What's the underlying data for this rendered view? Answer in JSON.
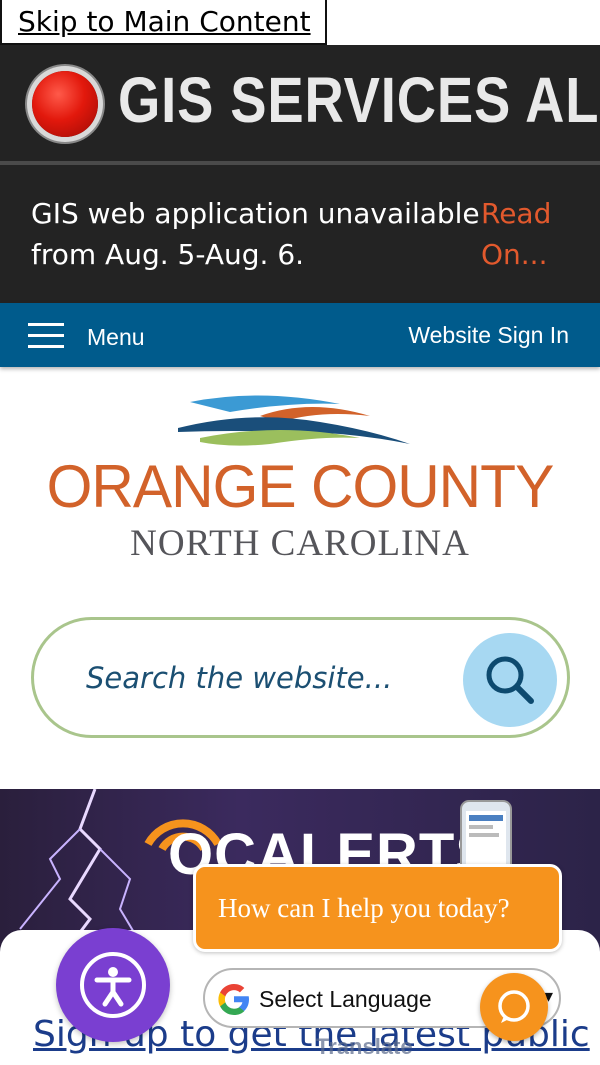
{
  "skip_link": "Skip to Main Content",
  "alert": {
    "title": "GIS SERVICES ALERT",
    "message": "GIS web application unavailable from Aug. 5-Aug. 6.",
    "read_more": "Read On..."
  },
  "nav": {
    "menu_label": "Menu",
    "sign_in": "Website Sign In"
  },
  "logo": {
    "line1": "ORANGE COUNTY",
    "line2": "NORTH CAROLINA"
  },
  "search": {
    "placeholder": "Search the website...",
    "icon": "search-icon"
  },
  "banner": {
    "oc": "OC",
    "title": "ALERTS"
  },
  "signup_link": "Sign up to get the latest public",
  "chat": {
    "prompt": "How can I help you today?"
  },
  "translate": {
    "label": "Select Language",
    "powered_by": "Translate"
  },
  "colors": {
    "nav_blue": "#005b8c",
    "alert_red": "#e2180c",
    "link_orange": "#e2592d",
    "chat_orange": "#f6931d",
    "a11y_purple": "#7a3fd1"
  }
}
